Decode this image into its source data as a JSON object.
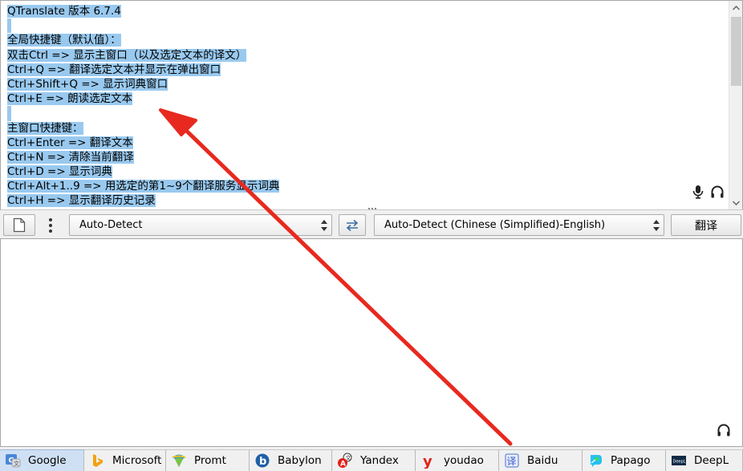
{
  "source": {
    "lines": [
      "QTranslate 版本 6.7.4",
      "",
      "全局快捷键（默认值）：",
      "双击Ctrl => 显示主窗口（以及选定文本的译文）",
      "Ctrl+Q => 翻译选定文本并显示在弹出窗口",
      "Ctrl+Shift+Q => 显示词典窗口",
      "Ctrl+E => 朗读选定文本",
      "",
      "主窗口快捷键：",
      "Ctrl+Enter => 翻译文本",
      "Ctrl+N => 清除当前翻译",
      "Ctrl+D => 显示词典",
      "Ctrl+Alt+1..9 => 用选定的第1~9个翻译服务显示词典",
      "Ctrl+H => 显示翻译历史记录"
    ],
    "selection_color": "#99c9ef"
  },
  "toolbar": {
    "source_lang": "Auto-Detect",
    "target_lang": "Auto-Detect (Chinese (Simplified)-English)",
    "translate_label": "翻译"
  },
  "services": [
    {
      "name": "Google",
      "icon": "google-icon",
      "active": true
    },
    {
      "name": "Microsoft",
      "icon": "microsoft-bing-icon",
      "active": false
    },
    {
      "name": "Promt",
      "icon": "promt-icon",
      "active": false
    },
    {
      "name": "Babylon",
      "icon": "babylon-icon",
      "active": false
    },
    {
      "name": "Yandex",
      "icon": "yandex-icon",
      "active": false
    },
    {
      "name": "youdao",
      "icon": "youdao-icon",
      "active": false
    },
    {
      "name": "Baidu",
      "icon": "baidu-icon",
      "active": false
    },
    {
      "name": "Papago",
      "icon": "papago-icon",
      "active": false
    },
    {
      "name": "DeepL",
      "icon": "deepl-icon",
      "active": false
    }
  ],
  "colors": {
    "accent_tab": "#cfe0f4",
    "annotation_arrow": "#e8291f"
  }
}
